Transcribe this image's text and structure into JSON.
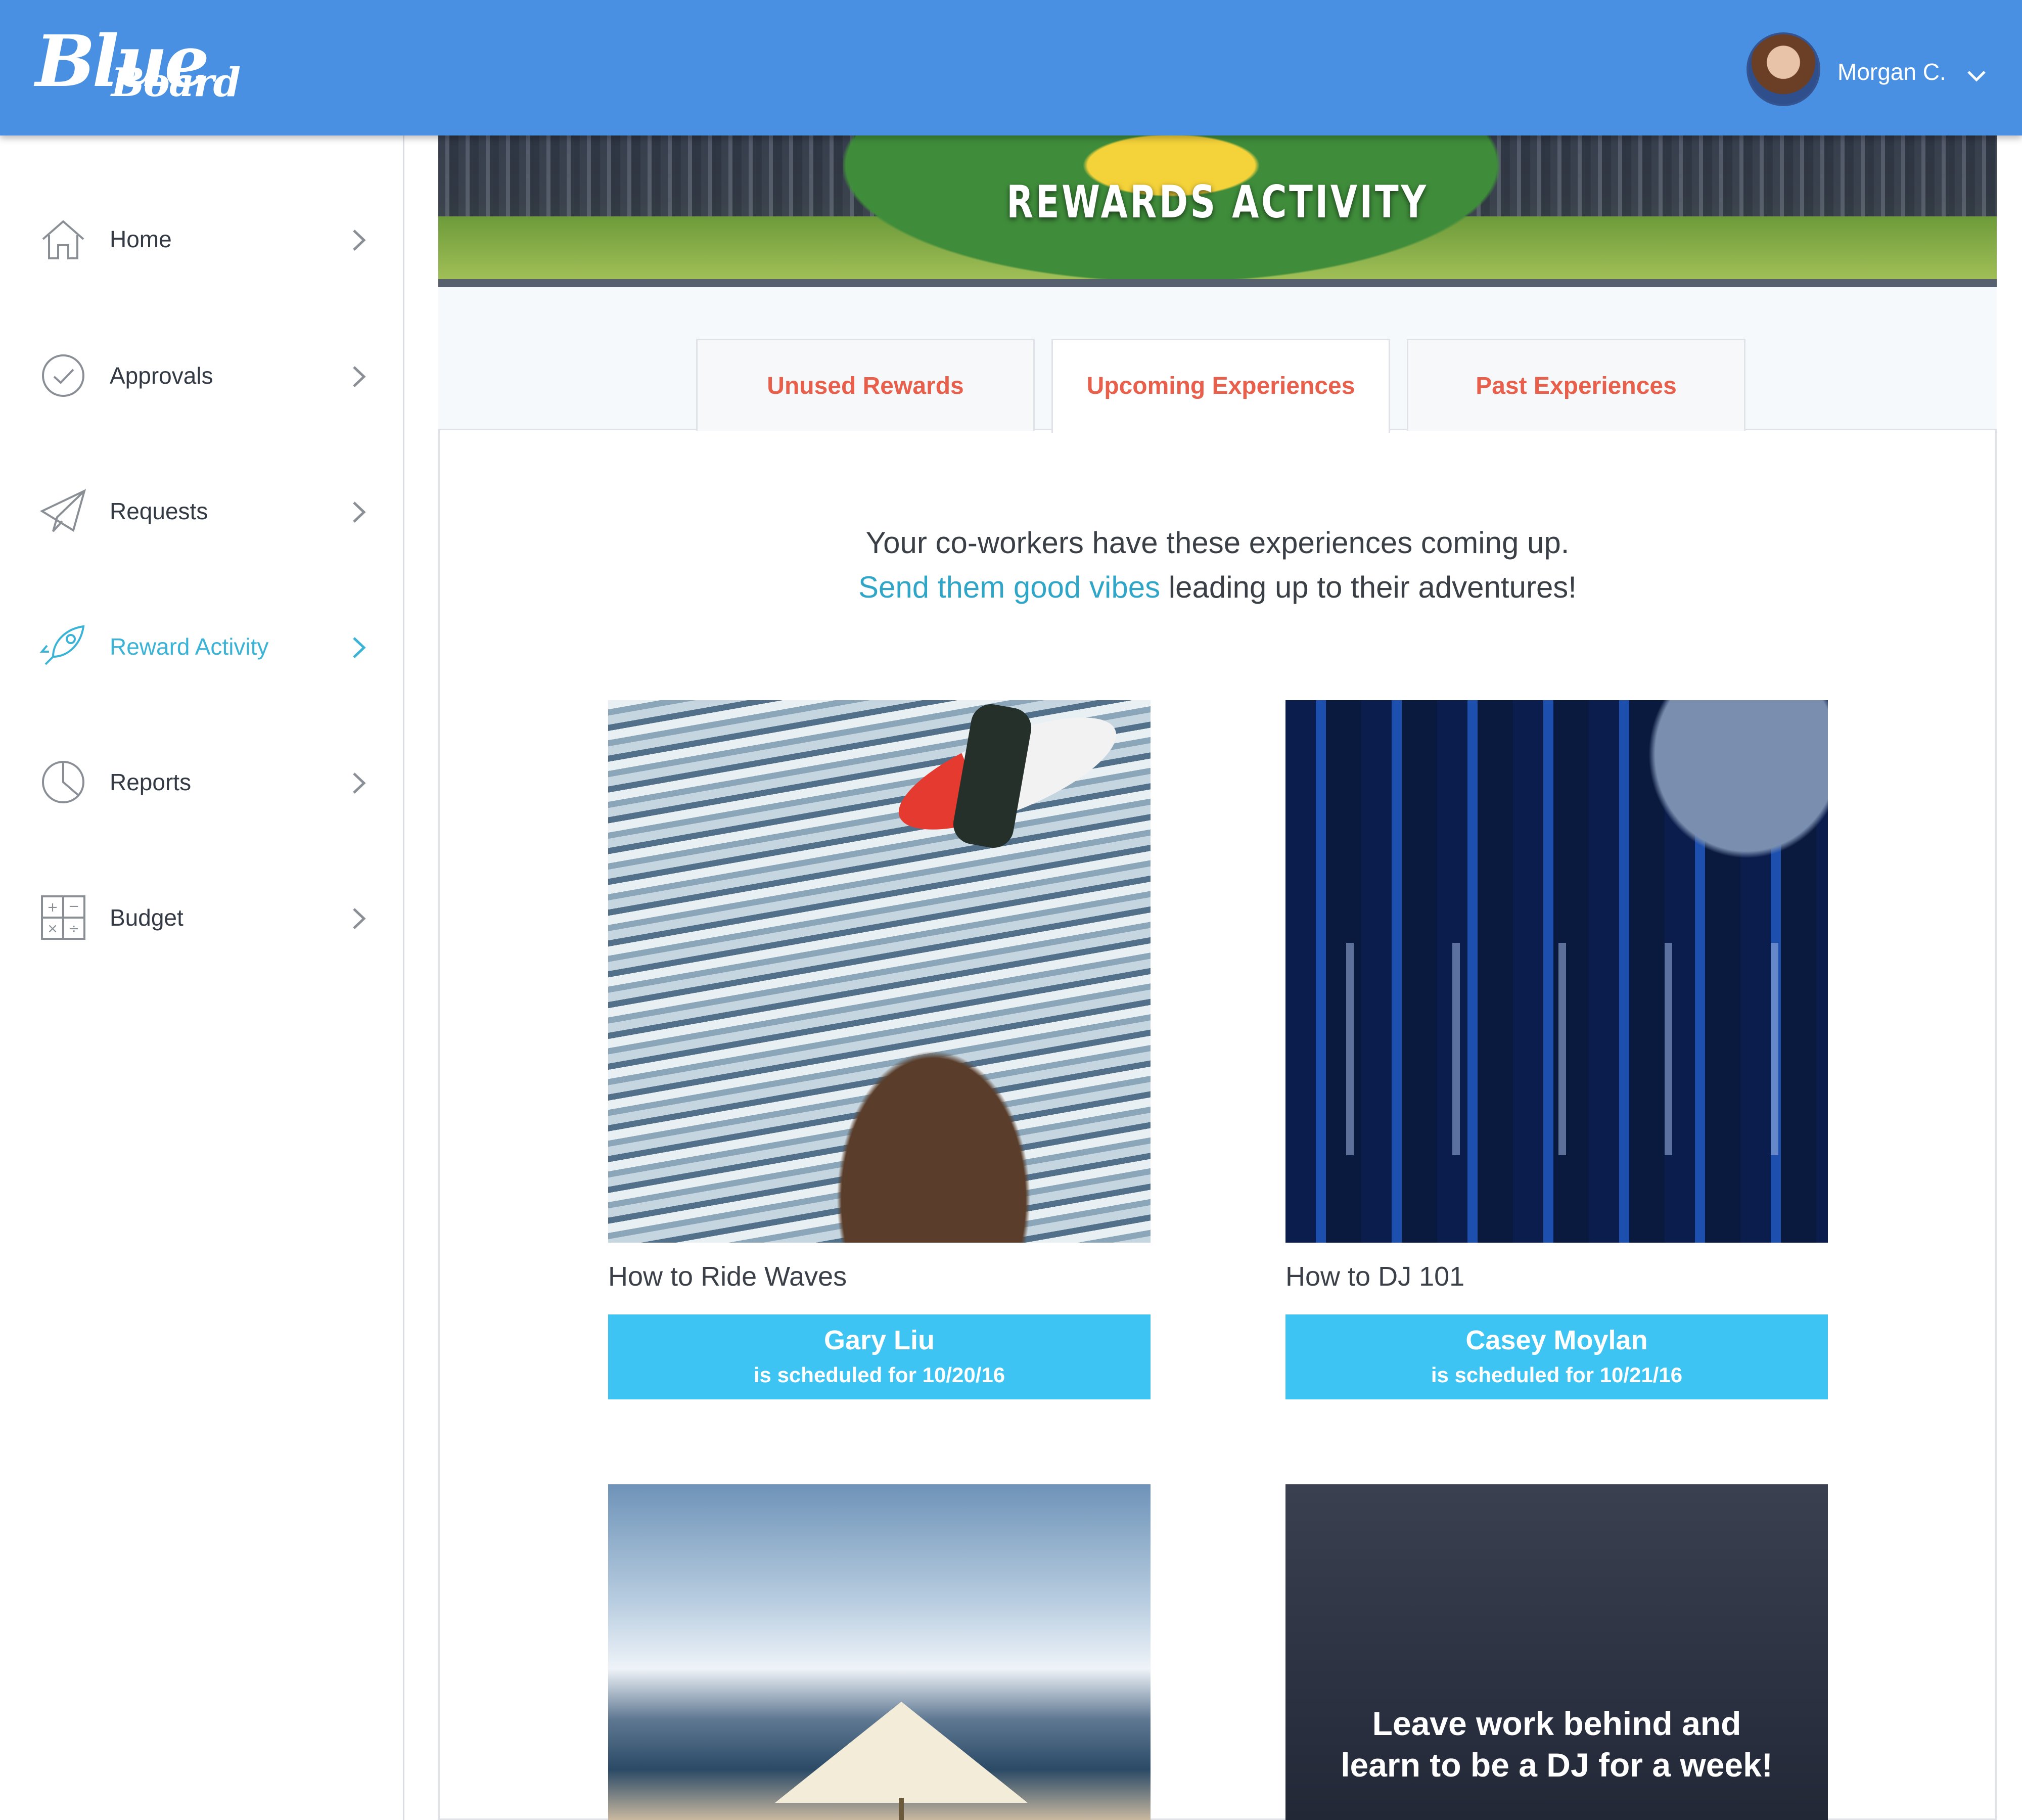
{
  "header": {
    "logo_text_1": "Blue",
    "logo_text_2": "Board",
    "user_name": "Morgan C."
  },
  "sidebar": {
    "items": [
      {
        "label": "Home",
        "icon": "home-icon"
      },
      {
        "label": "Approvals",
        "icon": "check-circle-icon"
      },
      {
        "label": "Requests",
        "icon": "paper-plane-icon"
      },
      {
        "label": "Reward Activity",
        "icon": "rocket-icon",
        "active": true
      },
      {
        "label": "Reports",
        "icon": "pie-chart-icon"
      },
      {
        "label": "Budget",
        "icon": "calculator-icon"
      }
    ]
  },
  "banner": {
    "title": "REWARDS ACTIVITY"
  },
  "tabs": [
    {
      "label": "Unused Rewards"
    },
    {
      "label": "Upcoming Experiences",
      "active": true
    },
    {
      "label": "Past Experiences"
    }
  ],
  "intro": {
    "line1": "Your co-workers have these experiences coming up.",
    "link_text": "Send them good vibes",
    "line2_rest": " leading up to their adventures!"
  },
  "cards": [
    {
      "title": "How to Ride Waves",
      "person": "Gary Liu",
      "schedule": "is scheduled for 10/20/16"
    },
    {
      "title": "How to DJ 101",
      "person": "Casey Moylan",
      "schedule": "is scheduled for 10/21/16"
    }
  ],
  "promo": {
    "line1": "Leave work behind and",
    "line2": "learn to be a DJ for a week!"
  },
  "colors": {
    "header_bg": "#4a90e2",
    "accent_tab_text": "#e8604c",
    "active_nav": "#3bb3d6",
    "schedule_button": "#3ec4f2"
  }
}
